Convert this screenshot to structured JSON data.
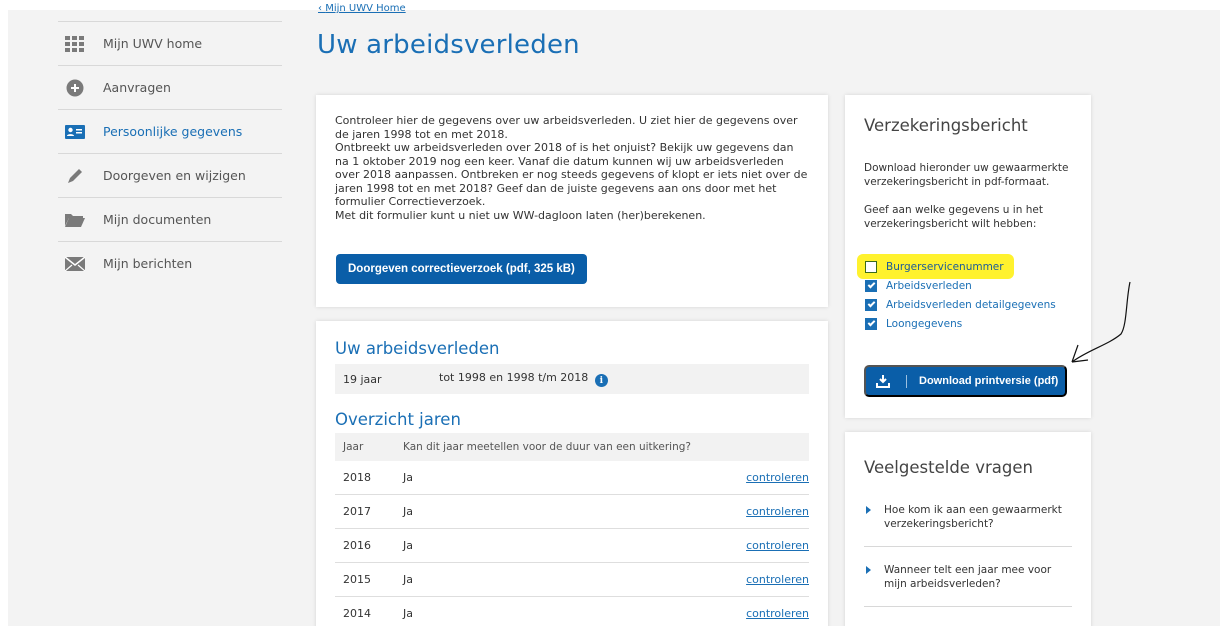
{
  "sidebar": {
    "items": [
      {
        "label": "Mijn UWV home",
        "icon": "grid-icon"
      },
      {
        "label": "Aanvragen",
        "icon": "plus-circle-icon"
      },
      {
        "label": "Persoonlijke gegevens",
        "icon": "id-card-icon",
        "active": true
      },
      {
        "label": "Doorgeven en wijzigen",
        "icon": "pencil-icon"
      },
      {
        "label": "Mijn documenten",
        "icon": "folder-icon"
      },
      {
        "label": "Mijn berichten",
        "icon": "envelope-icon"
      }
    ]
  },
  "header": {
    "breadcrumb": "Mijn UWV Home",
    "title": "Uw arbeidsverleden"
  },
  "intro": {
    "text": [
      "Controleer hier de gegevens over uw arbeidsverleden. U ziet hier de gegevens over de jaren 1998 tot en met 2018.",
      "Ontbreekt uw arbeidsverleden over 2018 of is het onjuist? Bekijk uw gegevens dan na 1 oktober 2019 nog een keer. Vanaf die datum kunnen wij uw arbeidsverleden over 2018 aanpassen. Ontbreken er nog steeds gegevens of klopt er iets niet over de jaren 1998 tot en met 2018? Geef dan de juiste gegevens aan ons door met het formulier Correctieverzoek.",
      "Met dit formulier kunt u niet uw WW-dagloon laten (her)berekenen."
    ],
    "button_label": "Doorgeven correctieverzoek (pdf, 325 kB)"
  },
  "history": {
    "title": "Uw arbeidsverleden",
    "years": "19 jaar",
    "period": "tot 1998 en 1998 t/m 2018",
    "info_symbol": "i",
    "overview_title": "Overzicht jaren",
    "col_year": "Jaar",
    "col_question": "Kan dit jaar meetellen voor de duur van een uitkering?",
    "rows": [
      {
        "year": "2018",
        "value": "Ja",
        "link": "controleren"
      },
      {
        "year": "2017",
        "value": "Ja",
        "link": "controleren"
      },
      {
        "year": "2016",
        "value": "Ja",
        "link": "controleren"
      },
      {
        "year": "2015",
        "value": "Ja",
        "link": "controleren"
      },
      {
        "year": "2014",
        "value": "Ja",
        "link": "controleren"
      }
    ]
  },
  "insurance": {
    "title": "Verzekeringsbericht",
    "text1": "Download hieronder uw gewaarmerkte verzekeringsbericht in pdf-formaat.",
    "text2": "Geef aan welke gegevens u in het verzekeringsbericht wilt hebben:",
    "options": [
      {
        "label": "Burgerservicenummer",
        "checked": false
      },
      {
        "label": "Arbeidsverleden",
        "checked": true
      },
      {
        "label": "Arbeidsverleden detailgegevens",
        "checked": true
      },
      {
        "label": "Loongegevens",
        "checked": true
      }
    ],
    "download_label": "Download printversie (pdf)"
  },
  "faq": {
    "title": "Veelgestelde vragen",
    "items": [
      "Hoe kom ik aan een gewaarmerkt verzekeringsbericht?",
      "Wanneer telt een jaar mee voor mijn arbeidsverleden?"
    ]
  },
  "colors": {
    "accent": "#1a6fb5",
    "button": "#0a5ea8",
    "highlight": "#fff22e"
  }
}
